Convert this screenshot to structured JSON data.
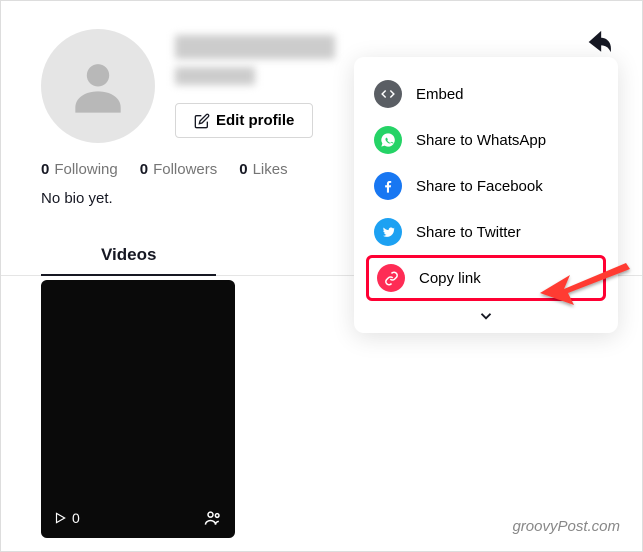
{
  "profile": {
    "edit_label": "Edit profile",
    "stats": {
      "following_count": "0",
      "following_label": "Following",
      "followers_count": "0",
      "followers_label": "Followers",
      "likes_count": "0",
      "likes_label": "Likes"
    },
    "bio": "No bio yet."
  },
  "tabs": {
    "videos": "Videos"
  },
  "video": {
    "views": "0"
  },
  "share_menu": {
    "embed": "Embed",
    "whatsapp": "Share to WhatsApp",
    "facebook": "Share to Facebook",
    "twitter": "Share to Twitter",
    "copy_link": "Copy link"
  },
  "watermark": "groovyPost.com",
  "colors": {
    "embed": "#5a5e64",
    "whatsapp": "#25d366",
    "facebook": "#1877f2",
    "twitter": "#1da1f2",
    "link": "#fe2c55",
    "highlight": "#ff0033"
  }
}
